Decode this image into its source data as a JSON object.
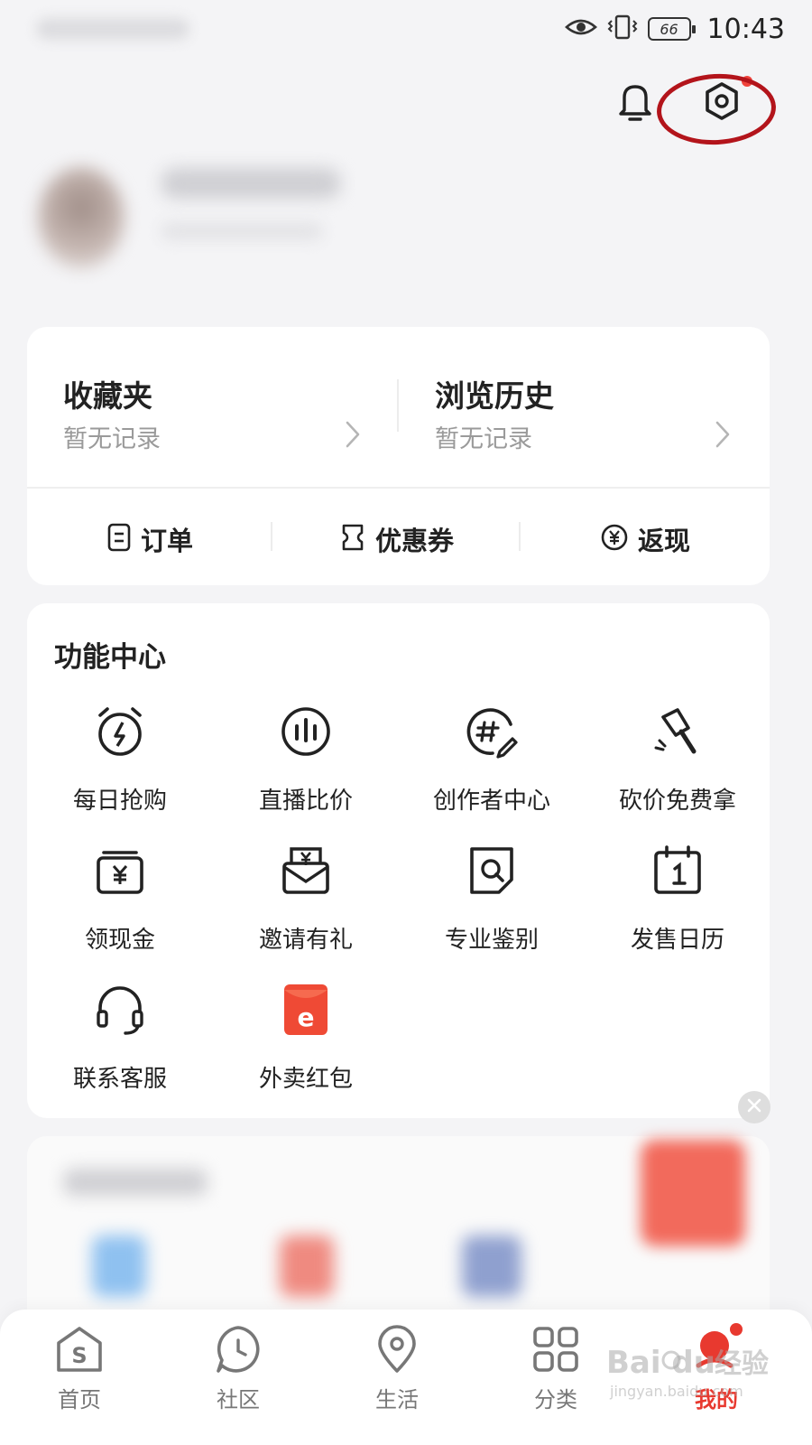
{
  "status_bar": {
    "battery": "66",
    "time": "10:43"
  },
  "header": {
    "icons": [
      "bell-icon",
      "settings-icon"
    ],
    "settings_notification_dot": true,
    "annotation_color": "#b3141b"
  },
  "summary": {
    "favorites": {
      "title": "收藏夹",
      "subtitle": "暂无记录"
    },
    "history": {
      "title": "浏览历史",
      "subtitle": "暂无记录"
    },
    "quick_links": [
      {
        "label": "订单",
        "icon": "order-icon"
      },
      {
        "label": "优惠券",
        "icon": "coupon-icon"
      },
      {
        "label": "返现",
        "icon": "cashback-icon"
      }
    ]
  },
  "functions": {
    "title": "功能中心",
    "items": [
      {
        "label": "每日抢购",
        "icon": "alarm-clock-icon"
      },
      {
        "label": "直播比价",
        "icon": "live-bars-icon"
      },
      {
        "label": "创作者中心",
        "icon": "hashtag-pen-icon"
      },
      {
        "label": "砍价免费拿",
        "icon": "axe-icon"
      },
      {
        "label": "领现金",
        "icon": "cash-wallet-icon"
      },
      {
        "label": "邀请有礼",
        "icon": "gift-envelope-icon"
      },
      {
        "label": "专业鉴别",
        "icon": "authenticate-icon"
      },
      {
        "label": "发售日历",
        "icon": "calendar-icon"
      },
      {
        "label": "联系客服",
        "icon": "headset-icon"
      },
      {
        "label": "外卖红包",
        "icon": "red-envelope-icon"
      }
    ]
  },
  "bottom_nav": {
    "items": [
      {
        "label": "首页",
        "icon": "home-icon",
        "active": false
      },
      {
        "label": "社区",
        "icon": "community-icon",
        "active": false
      },
      {
        "label": "生活",
        "icon": "location-pin-icon",
        "active": false
      },
      {
        "label": "分类",
        "icon": "category-grid-icon",
        "active": false
      },
      {
        "label": "我的",
        "icon": "profile-icon",
        "active": true
      }
    ],
    "active_color": "#e8392f"
  }
}
